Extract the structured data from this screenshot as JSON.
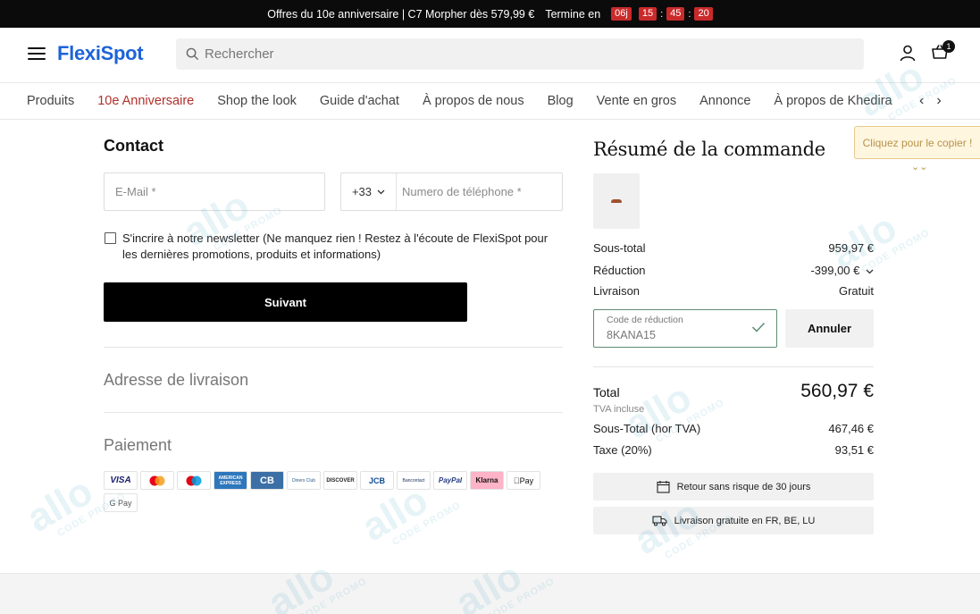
{
  "promo": {
    "text": "Offres du 10e anniversaire | C7 Morpher dès 579,99 €",
    "ends_label": "Termine en",
    "days": "06j",
    "hours": "15",
    "minutes": "45",
    "seconds": "20"
  },
  "header": {
    "logo": "FlexiSpot",
    "search_placeholder": "Rechercher",
    "cart_count": "1"
  },
  "nav": {
    "items": [
      "Produits",
      "10e Anniversaire",
      "Shop the look",
      "Guide d'achat",
      "À propos de nous",
      "Blog",
      "Vente en gros",
      "Annonce",
      "À propos de Khedira"
    ],
    "active_index": 1
  },
  "contact": {
    "title": "Contact",
    "email_placeholder": "E-Mail *",
    "country_code": "+33",
    "phone_placeholder": "Numero de téléphone *",
    "newsletter_label": "S'incrire à notre newsletter (Ne manquez rien ! Restez à l'écoute de FlexiSpot pour les dernières promotions, produits et informations)",
    "next_button": "Suivant"
  },
  "sections": {
    "shipping_title": "Adresse de livraison",
    "payment_title": "Paiement"
  },
  "payment_methods": [
    "VISA",
    "Mastercard",
    "Maestro",
    "AMERICAN EXPRESS",
    "CB",
    "Diners Club",
    "DISCOVER",
    "JCB",
    "Bancontact",
    "PayPal",
    "Klarna",
    "Apple Pay",
    "G Pay"
  ],
  "summary": {
    "title": "Résumé de la commande",
    "subtotal_label": "Sous-total",
    "subtotal_value": "959,97 €",
    "discount_label": "Réduction",
    "discount_value": "-399,00 €",
    "shipping_label": "Livraison",
    "shipping_value": "Gratuit",
    "coupon_label": "Code de réduction",
    "coupon_value": "8KANA15",
    "cancel_button": "Annuler",
    "total_label": "Total",
    "total_value": "560,97 €",
    "tva_note": "TVA incluse",
    "subtotal_ht_label": "Sous-Total (hor TVA)",
    "subtotal_ht_value": "467,46 €",
    "tax_label": "Taxe (20%)",
    "tax_value": "93,51 €",
    "return_policy": "Retour sans risque de 30 jours",
    "free_delivery": "Livraison gratuite en FR, BE, LU"
  },
  "copy_tip": "Cliquez pour le copier !",
  "colors": {
    "brand": "#1d63d8",
    "accent_red": "#b0302a",
    "timer_red": "#c92a2a",
    "coupon_valid": "#5e8c74"
  }
}
